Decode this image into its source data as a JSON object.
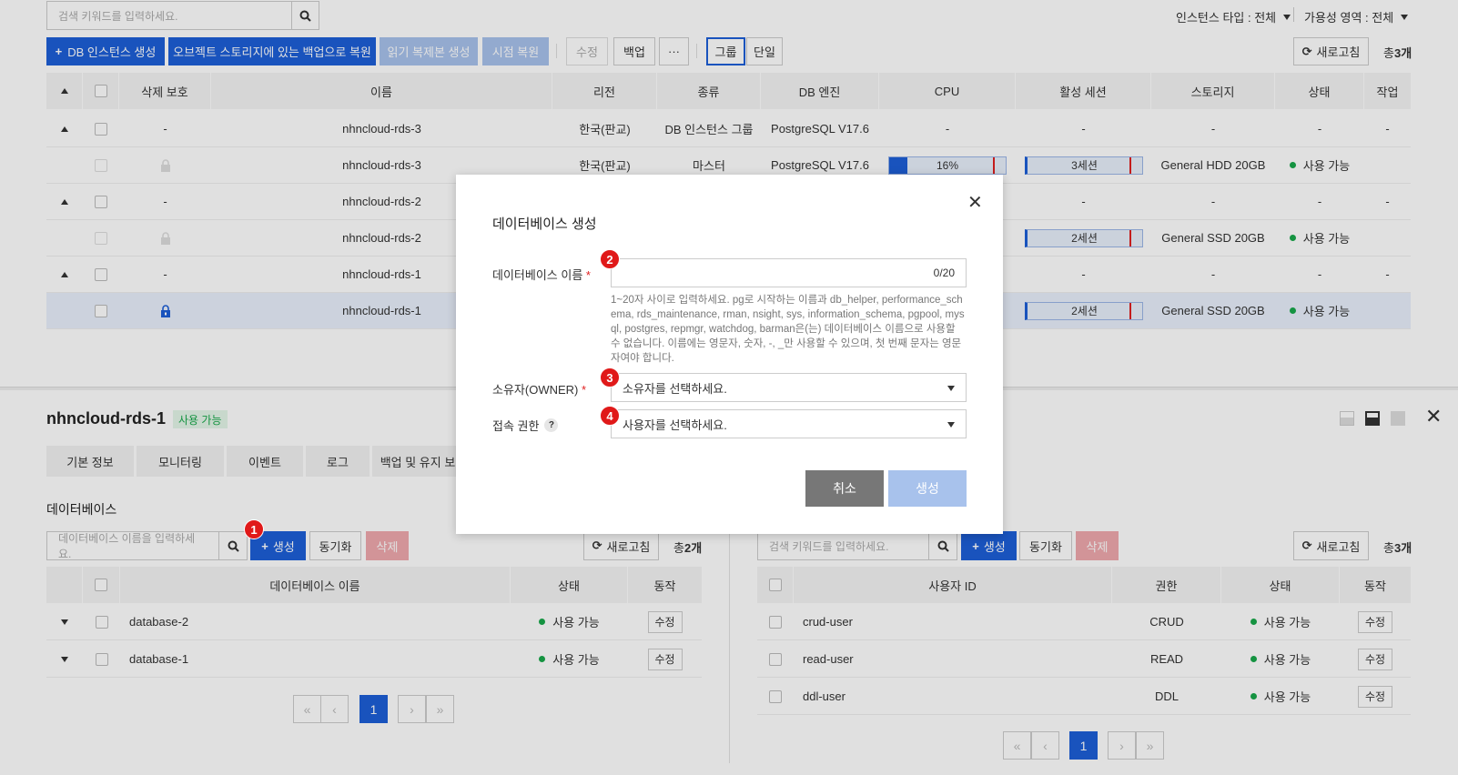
{
  "toolbar": {
    "search_placeholder": "검색 키워드를 입력하세요.",
    "instance_type": "인스턴스 타입 : 전체",
    "availability_zone": "가용성 영역 : 전체",
    "create_instance": "DB 인스턴스 생성",
    "restore_backup": "오브젝트 스토리지에 있는 백업으로 복원",
    "create_replica": "읽기 복제본 생성",
    "pitr": "시점 복원",
    "edit": "수정",
    "backup": "백업",
    "more": "···",
    "group": "그룹",
    "single": "단일",
    "refresh": "새로고침",
    "total_prefix": "총",
    "total_count": "3개"
  },
  "instance_table": {
    "headers": [
      "삭제 보호",
      "이름",
      "리전",
      "종류",
      "DB 엔진",
      "CPU",
      "활성 세션",
      "스토리지",
      "상태",
      "작업"
    ],
    "rows": [
      {
        "name": "nhncloud-rds-3",
        "region": "한국(판교)",
        "kind": "DB 인스턴스 그룹",
        "engine": "PostgreSQL V17.6",
        "protect": "-",
        "cpu": "-",
        "session": "-",
        "storage": "-",
        "status": "-",
        "action": "-"
      },
      {
        "name": "nhncloud-rds-3",
        "region": "한국(판교)",
        "kind": "마스터",
        "engine": "PostgreSQL V17.6",
        "cpu": "16%",
        "cpu_fraction": 0.16,
        "session": "3세션",
        "storage": "General HDD 20GB",
        "status": "사용 가능"
      },
      {
        "name": "nhncloud-rds-2",
        "protect": "-",
        "storage": "-",
        "status": "-",
        "action": "-",
        "session": "-"
      },
      {
        "name": "nhncloud-rds-2",
        "session": "2세션",
        "storage": "General SSD 20GB",
        "status": "사용 가능"
      },
      {
        "name": "nhncloud-rds-1",
        "protect": "-",
        "storage": "-",
        "status": "-",
        "action": "-",
        "session": "-"
      },
      {
        "name": "nhncloud-rds-1",
        "session": "2세션",
        "storage": "General SSD 20GB",
        "status": "사용 가능"
      }
    ]
  },
  "detail": {
    "title": "nhncloud-rds-1",
    "status": "사용 가능",
    "tabs": [
      "기본 정보",
      "모니터링",
      "이벤트",
      "로그",
      "백업 및 유지 보"
    ],
    "section_title": "데이터베이스"
  },
  "db_panel": {
    "search_placeholder": "데이터베이스 이름을 입력하세요.",
    "create": "생성",
    "sync": "동기화",
    "delete": "삭제",
    "refresh": "새로고침",
    "total_prefix": "총",
    "total_count": "2개",
    "headers": [
      "데이터베이스 이름",
      "상태",
      "동작"
    ],
    "rows": [
      {
        "name": "database-2",
        "status": "사용 가능",
        "action": "수정"
      },
      {
        "name": "database-1",
        "status": "사용 가능",
        "action": "수정"
      }
    ],
    "page": "1"
  },
  "user_panel": {
    "search_placeholder": "검색 키워드를 입력하세요.",
    "create": "생성",
    "sync": "동기화",
    "delete": "삭제",
    "refresh": "새로고침",
    "total_prefix": "총",
    "total_count": "3개",
    "headers": [
      "사용자 ID",
      "권한",
      "상태",
      "동작"
    ],
    "rows": [
      {
        "id": "crud-user",
        "perm": "CRUD",
        "status": "사용 가능",
        "action": "수정"
      },
      {
        "id": "read-user",
        "perm": "READ",
        "status": "사용 가능",
        "action": "수정"
      },
      {
        "id": "ddl-user",
        "perm": "DDL",
        "status": "사용 가능",
        "action": "수정"
      }
    ],
    "page": "1"
  },
  "modal": {
    "title": "데이터베이스 생성",
    "name_label": "데이터베이스 이름",
    "name_counter": "0/20",
    "name_help": "1~20자 사이로 입력하세요. pg로 시작하는 이름과 db_helper, performance_schema, rds_maintenance, rman, nsight, sys, information_schema, pgpool, mysql, postgres, repmgr, watchdog, barman은(는) 데이터베이스 이름으로 사용할 수 없습니다. 이름에는 영문자, 숫자, -, _만 사용할 수 있으며, 첫 번째 문자는 영문자여야 합니다.",
    "owner_label": "소유자(OWNER)",
    "owner_placeholder": "소유자를 선택하세요.",
    "access_label": "접속 권한",
    "access_placeholder": "사용자를 선택하세요.",
    "cancel": "취소",
    "submit": "생성",
    "required_mark": "*"
  },
  "callouts": [
    "1",
    "2",
    "3",
    "4"
  ],
  "colors": {
    "primary": "#1d5fd8",
    "success": "#18a84a",
    "danger_badge": "#e01919",
    "selected_row": "#e9f0fc"
  }
}
